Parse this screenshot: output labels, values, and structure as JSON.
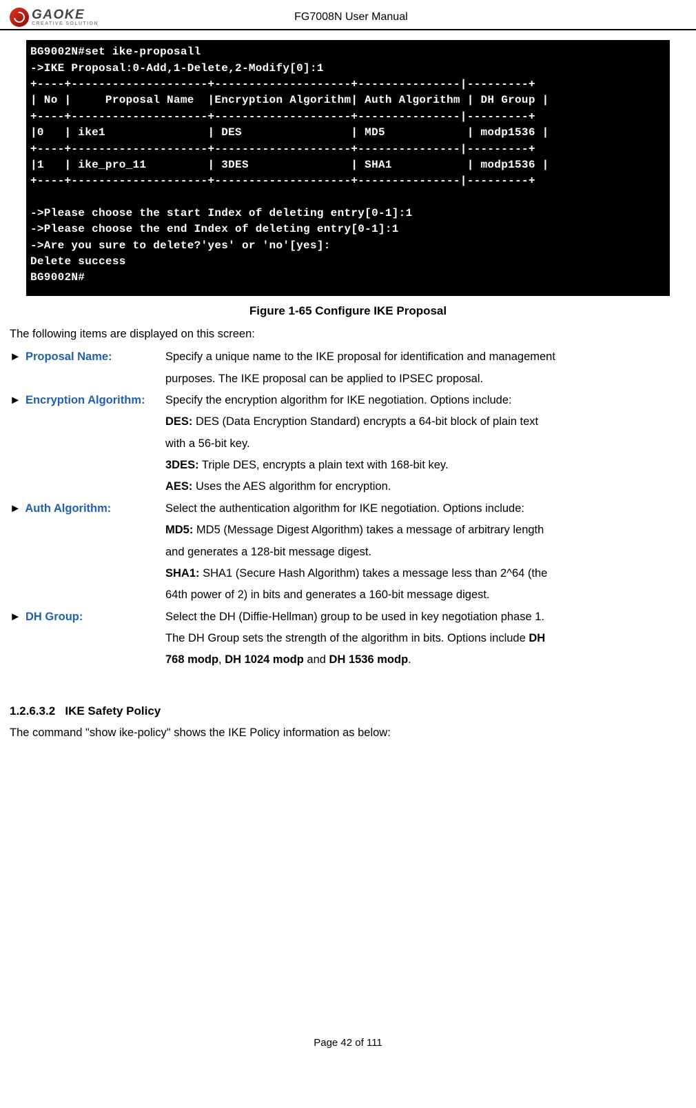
{
  "header": {
    "brand": "GAOKE",
    "tagline": "CREATIVE SOLUTION",
    "title": "FG7008N User Manual"
  },
  "terminal": {
    "lines": [
      "BG9002N#set ike-proposall",
      "->IKE Proposal:0-Add,1-Delete,2-Modify[0]:1",
      "+----+--------------------+--------------------+---------------|---------+",
      "| No |     Proposal Name  |Encryption Algorithm| Auth Algorithm | DH Group |",
      "+----+--------------------+--------------------+---------------|---------+",
      "|0   | ike1               | DES                | MD5            | modp1536 |",
      "+----+--------------------+--------------------+---------------|---------+",
      "|1   | ike_pro_11         | 3DES               | SHA1           | modp1536 |",
      "+----+--------------------+--------------------+---------------|---------+",
      "",
      "->Please choose the start Index of deleting entry[0-1]:1",
      "->Please choose the end Index of deleting entry[0-1]:1",
      "->Are you sure to delete?'yes' or 'no'[yes]:",
      "Delete success",
      "BG9002N#"
    ]
  },
  "figure_caption": "Figure 1-65   Configure IKE Proposal",
  "intro": "The following items are displayed on this screen:",
  "items": {
    "proposal_name": {
      "label": "Proposal Name:",
      "desc1": "Specify a unique name to the IKE proposal for identification and management",
      "desc2": "purposes. The IKE proposal can be applied to IPSEC proposal."
    },
    "encryption": {
      "label": "Encryption Algorithm:",
      "desc1": "Specify the encryption algorithm for IKE negotiation. Options include:",
      "des_label": "DES:",
      "des_text1": " DES (Data Encryption Standard) encrypts a 64-bit block of plain text",
      "des_text2": "with a 56-bit key.",
      "tdes_label": "3DES:",
      "tdes_text": " Triple DES, encrypts a plain text with 168-bit key.",
      "aes_label": "AES:",
      "aes_text": " Uses the AES algorithm for encryption."
    },
    "auth": {
      "label": "Auth Algorithm:",
      "desc1": "Select the authentication algorithm for IKE negotiation. Options include:",
      "md5_label": "MD5:",
      "md5_text1": " MD5 (Message Digest Algorithm) takes a message of arbitrary length",
      "md5_text2": "and generates a 128-bit message digest.",
      "sha1_label": "SHA1:",
      "sha1_text1": " SHA1 (Secure Hash Algorithm) takes a message less than 2^64 (the",
      "sha1_text2": "64th power of 2) in bits and generates a 160-bit message digest."
    },
    "dh": {
      "label": "DH Group:",
      "desc1": "Select the DH (Diffie-Hellman) group to be used in key negotiation phase 1.",
      "desc2a": "The DH Group sets the strength of the algorithm in bits. Options include ",
      "desc2b": "DH",
      "desc3a": "768 modp",
      "desc3b": ", ",
      "desc3c": "DH 1024 modp",
      "desc3d": " and ",
      "desc3e": "DH 1536 modp",
      "desc3f": "."
    }
  },
  "section": {
    "number": "1.2.6.3.2",
    "title": "IKE Safety Policy",
    "text": "The command \"show ike-policy\" shows the IKE Policy information as below:"
  },
  "footer": "Page 42 of 111"
}
